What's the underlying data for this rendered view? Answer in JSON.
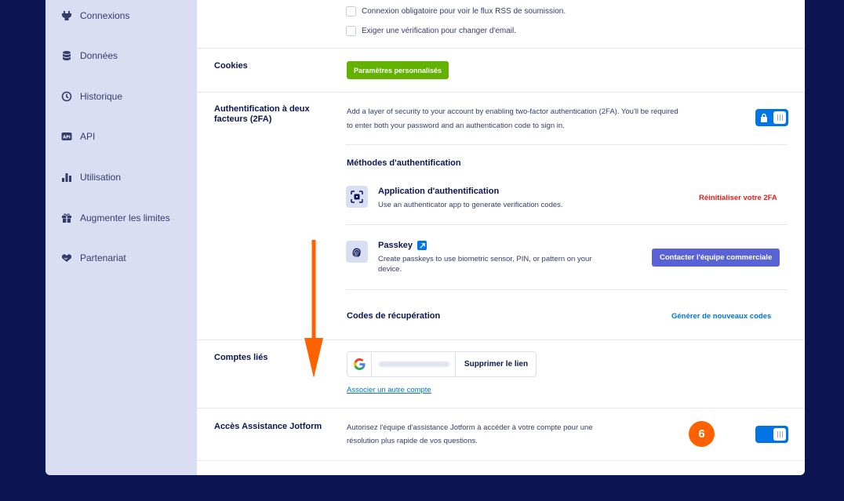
{
  "sidebar": {
    "items": [
      {
        "label": "Connexions",
        "icon": "plug-icon"
      },
      {
        "label": "Données",
        "icon": "database-icon"
      },
      {
        "label": "Historique",
        "icon": "history-icon"
      },
      {
        "label": "API",
        "icon": "api-icon"
      },
      {
        "label": "Utilisation",
        "icon": "bar-chart-icon"
      },
      {
        "label": "Augmenter les limites",
        "icon": "gift-icon"
      },
      {
        "label": "Partenariat",
        "icon": "handshake-icon"
      }
    ]
  },
  "security": {
    "rss_login_label": "Connexion obligatoire pour voir le flux RSS de soumission.",
    "email_verify_label": "Exiger une vérification pour changer d'email."
  },
  "cookies": {
    "label": "Cookies",
    "button": "Paramètres personnalisés"
  },
  "twofa": {
    "label": "Authentification à deux facteurs (2FA)",
    "description_line1": "Add a layer of security to your account by enabling two-factor authentication (2FA). You'll be required",
    "description_line2": "to enter both your password and an authentication code to sign in.",
    "methods_heading": "Méthodes d'authentification",
    "app_title": "Application d'authentification",
    "app_desc": "Use an authenticator app to generate verification codes.",
    "app_reset": "Réinitialiser votre 2FA",
    "passkey_title": "Passkey",
    "passkey_desc_line1": "Create passkeys to use biometric sensor, PIN, or pattern on your",
    "passkey_desc_line2": "device.",
    "passkey_button": "Contacter l'équipe commerciale",
    "recovery_heading": "Codes de récupération",
    "recovery_link": "Générer de nouveaux codes"
  },
  "linked": {
    "label": "Comptes liés",
    "unlink": "Supprimer le lien",
    "associate": "Associer un autre compte"
  },
  "support": {
    "label": "Accès Assistance Jotform",
    "description_line1": "Autorisez l'équipe d'assistance Jotform à accéder à votre compte pour une",
    "description_line2": "résolution plus rapide de vos questions.",
    "step_badge": "6"
  },
  "colors": {
    "background": "#0a1551",
    "sidebar": "#dadef3",
    "green": "#64b200",
    "blue": "#0075e3",
    "purple_button": "#5a63d6",
    "red": "#e0211e",
    "orange": "#ff6100"
  }
}
